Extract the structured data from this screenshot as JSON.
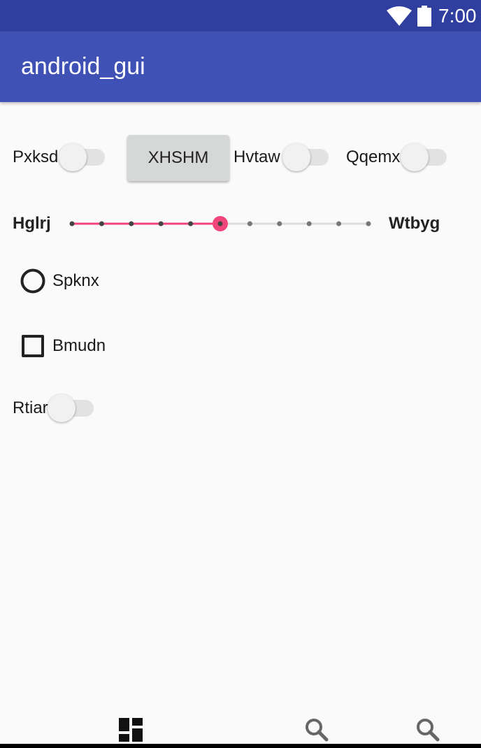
{
  "status_bar": {
    "time": "7:00",
    "icons": [
      "wifi-icon",
      "battery-icon"
    ]
  },
  "app_bar": {
    "title": "android_gui"
  },
  "row1": {
    "switch1_label": "Pxksd",
    "switch1_on": false,
    "button_label": "XHSHM",
    "switch2_label": "Hvtaw",
    "switch2_on": false,
    "switch3_label": "Qqemx",
    "switch3_on": false
  },
  "seekbar": {
    "left_label": "Hglrj",
    "right_label": "Wtbyg",
    "value": 5,
    "max": 10,
    "accent_color": "#f0467c"
  },
  "radio": {
    "label": "Spknx",
    "checked": false
  },
  "checkbox": {
    "label": "Bmudn",
    "checked": false
  },
  "switch4": {
    "label": "Rtiar",
    "on": false
  },
  "bottom_nav": {
    "items": [
      {
        "icon": "dashboard-icon"
      },
      {
        "icon": "search-icon"
      },
      {
        "icon": "search-icon"
      }
    ]
  }
}
